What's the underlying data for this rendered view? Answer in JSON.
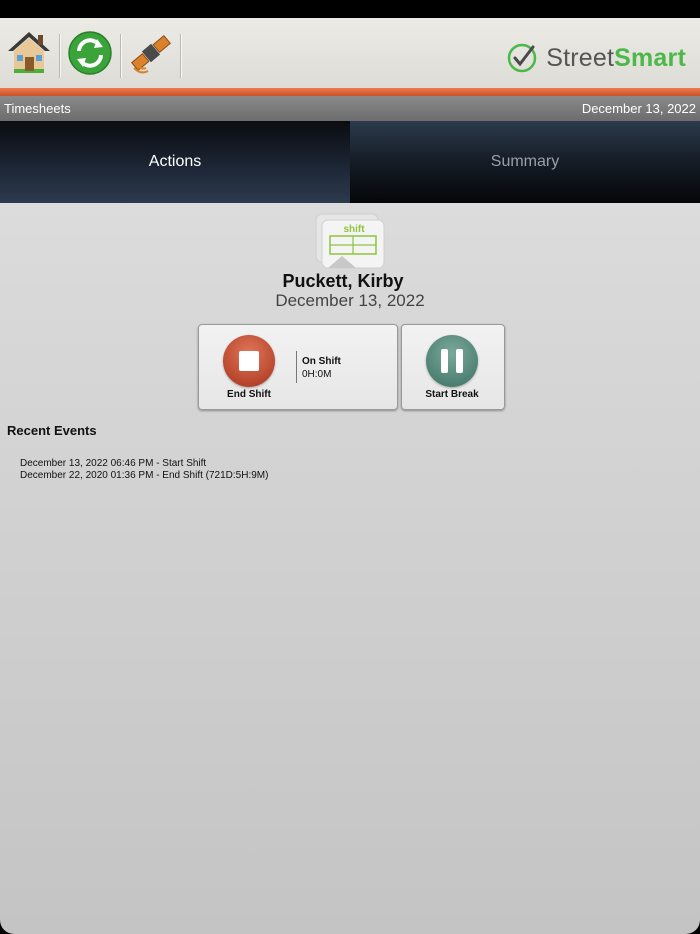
{
  "toolbar": {
    "home_icon": "home-icon",
    "sync_icon": "sync-icon",
    "gps_icon": "satellite-icon",
    "logo": {
      "prefix": "Street",
      "suffix": "Smart",
      "accent": "#4cb848"
    }
  },
  "header": {
    "title": "Timesheets",
    "date": "December 13, 2022"
  },
  "tabs": [
    {
      "label": "Actions",
      "active": true
    },
    {
      "label": "Summary",
      "active": false
    }
  ],
  "employee": {
    "icon_label": "shift",
    "name": "Puckett, Kirby",
    "date": "December 13, 2022"
  },
  "actions": {
    "end_shift": {
      "label": "End Shift",
      "color": "#b8462d"
    },
    "status": {
      "label": "On Shift",
      "duration": "0H:0M"
    },
    "start_break": {
      "label": "Start Break",
      "color": "#4f8274"
    }
  },
  "recent_events": {
    "title": "Recent Events",
    "items": [
      "December 13, 2022 06:46 PM - Start Shift",
      "December 22, 2020 01:36 PM - End Shift (721D:5H:9M)"
    ]
  },
  "colors": {
    "orange_bar": "#e0663a",
    "tab_active_text": "#ffffff",
    "tab_inactive_text": "#9aa0a8"
  }
}
